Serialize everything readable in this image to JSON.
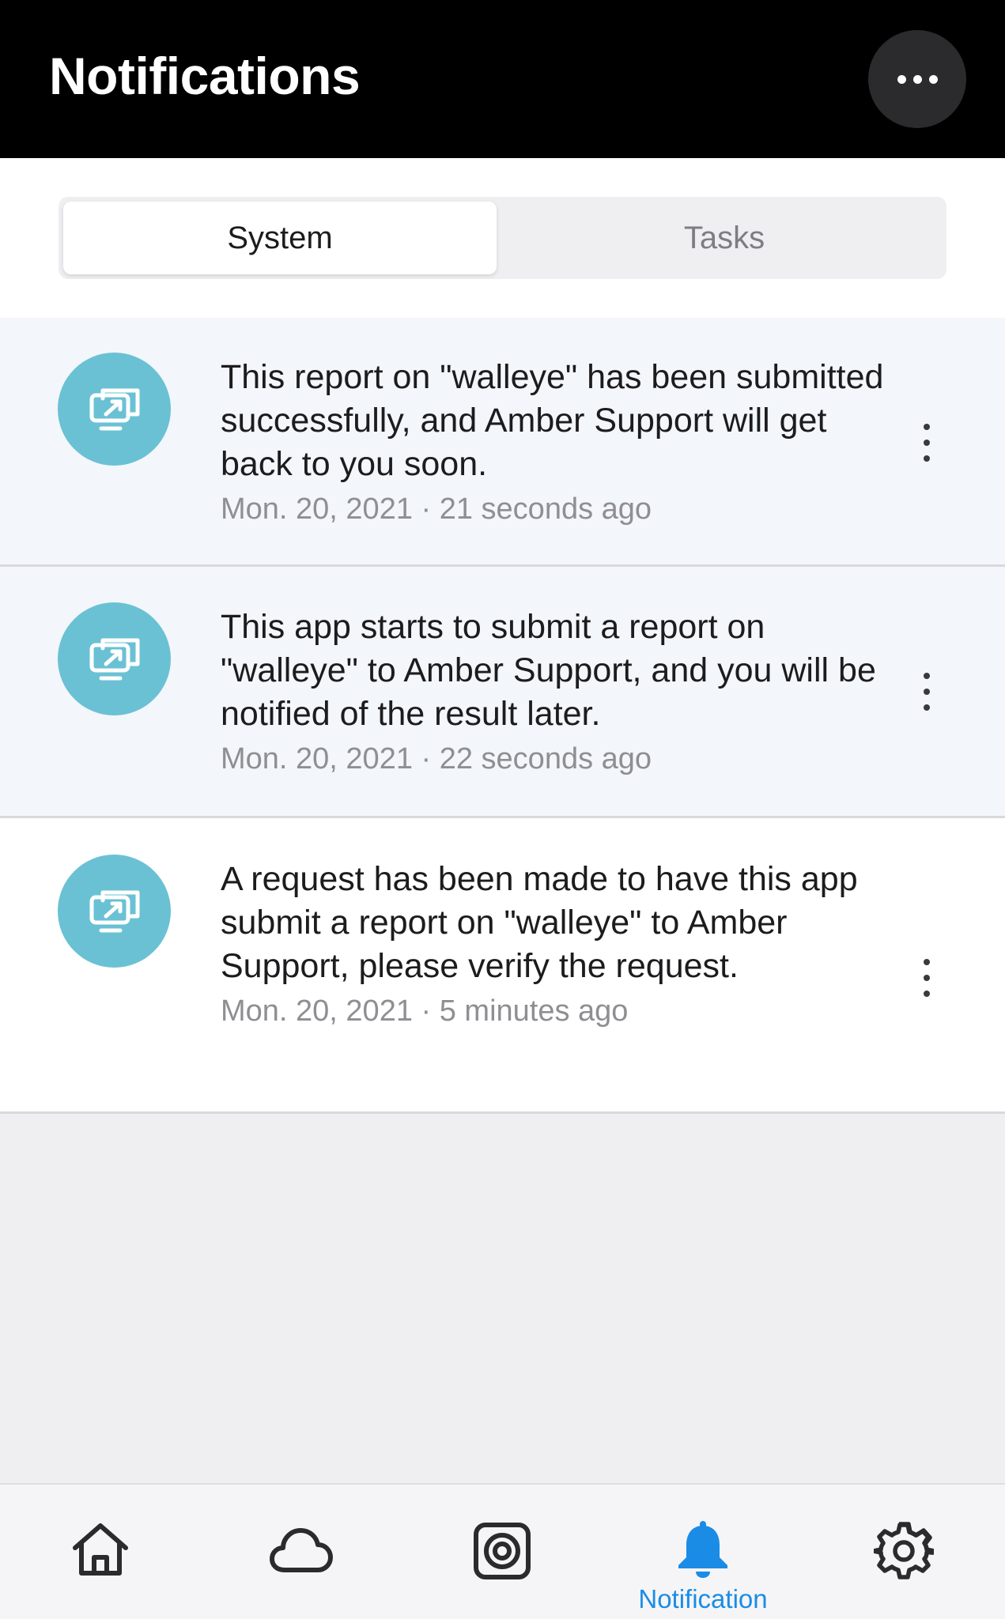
{
  "header": {
    "title": "Notifications",
    "more_icon": "more-horizontal-icon"
  },
  "tabs": {
    "items": [
      {
        "label": "System",
        "selected": true
      },
      {
        "label": "Tasks",
        "selected": false
      }
    ]
  },
  "notifications": [
    {
      "icon": "remote-screen-icon",
      "text": "This report on \"walleye\" has been submitted successfully, and Amber Support will get back to you soon.",
      "meta": "Mon. 20, 2021 · 21 seconds ago",
      "unread": true
    },
    {
      "icon": "remote-screen-icon",
      "text": "This app starts to submit a report on \"walleye\" to Amber Support, and you will be notified of the result later.",
      "meta": "Mon. 20, 2021 · 22 seconds ago",
      "unread": true
    },
    {
      "icon": "remote-screen-icon",
      "text": "A request has been made to have this app submit a report on \"walleye\" to Amber Support, please verify the request.",
      "meta": "Mon. 20, 2021 · 5 minutes ago",
      "unread": false
    }
  ],
  "tabbar": {
    "items": [
      {
        "icon": "home-icon",
        "label": ""
      },
      {
        "icon": "cloud-icon",
        "label": ""
      },
      {
        "icon": "target-square-icon",
        "label": ""
      },
      {
        "icon": "bell-icon",
        "label": "Notification",
        "active": true
      },
      {
        "icon": "gear-icon",
        "label": ""
      }
    ]
  },
  "colors": {
    "header_bg": "#000000",
    "icon_circle": "#6ac1d4",
    "accent": "#1a8ce6",
    "unread_bg": "#f3f6fa"
  }
}
